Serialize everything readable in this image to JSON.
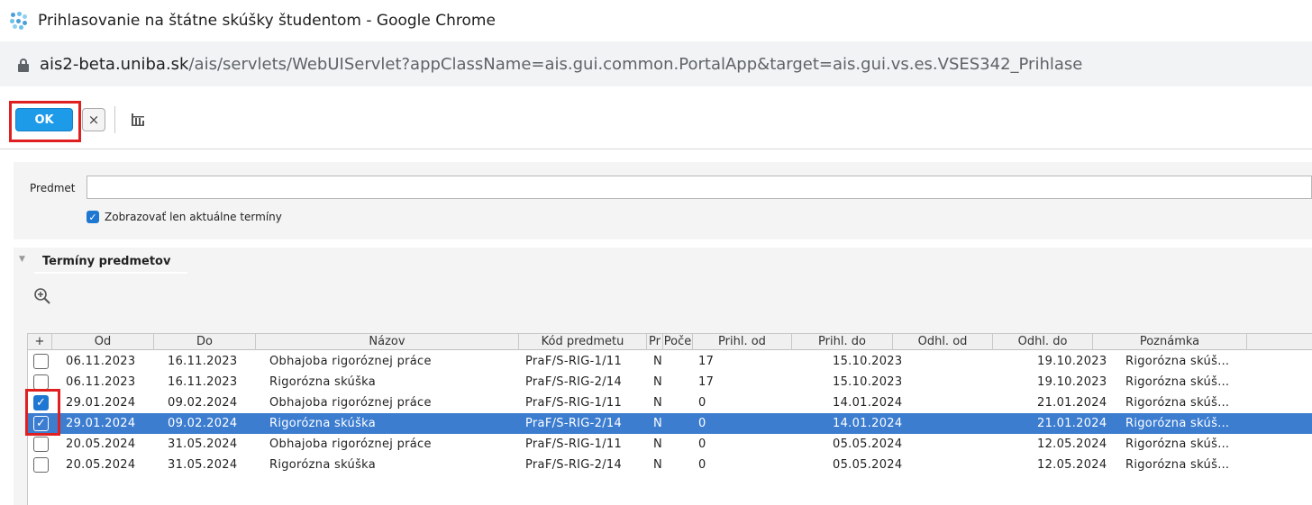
{
  "window": {
    "title": "Prihlasovanie na štátne skúšky študentom - Google Chrome",
    "url_host": "ais2-beta.uniba.sk",
    "url_path": "/ais/servlets/WebUIServlet?appClassName=ais.gui.common.PortalApp&target=ais.gui.vs.es.VSES342_Prihlase"
  },
  "toolbar": {
    "ok_label": "OK",
    "cancel_symbol": "×"
  },
  "filter": {
    "predmet_label": "Predmet",
    "predmet_value": "",
    "current_only_label": "Zobrazovať len aktuálne termíny",
    "current_only_checked": true
  },
  "section": {
    "title": "Termíny predmetov"
  },
  "table": {
    "add_symbol": "+",
    "columns": {
      "od": "Od",
      "do": "Do",
      "nazov": "Názov",
      "kod": "Kód predmetu",
      "pr": "Pr",
      "poc": "Poče",
      "prihl_od": "Prihl. od",
      "prihl_do": "Prihl. do",
      "odhl_od": "Odhl. od",
      "odhl_do": "Odhl. do",
      "poznamka": "Poznámka"
    },
    "rows": [
      {
        "checked": false,
        "selected": false,
        "od": "06.11.2023",
        "do": "16.11.2023",
        "nazov": "Obhajoba rigoróznej práce",
        "kod": "PraF/S-RIG-1/11",
        "pr": "N",
        "poc": "17",
        "prihl_do": "15.10.2023",
        "odhl_do": "19.10.2023",
        "poznamka": "Rigorózna skúš…"
      },
      {
        "checked": false,
        "selected": false,
        "od": "06.11.2023",
        "do": "16.11.2023",
        "nazov": "Rigorózna skúška",
        "kod": "PraF/S-RIG-2/14",
        "pr": "N",
        "poc": "17",
        "prihl_do": "15.10.2023",
        "odhl_do": "19.10.2023",
        "poznamka": "Rigorózna skúš…"
      },
      {
        "checked": true,
        "selected": false,
        "od": "29.01.2024",
        "do": "09.02.2024",
        "nazov": "Obhajoba rigoróznej práce",
        "kod": "PraF/S-RIG-1/11",
        "pr": "N",
        "poc": "0",
        "prihl_do": "14.01.2024",
        "odhl_do": "21.01.2024",
        "poznamka": "Rigorózna skúš…"
      },
      {
        "checked": true,
        "selected": true,
        "od": "29.01.2024",
        "do": "09.02.2024",
        "nazov": "Rigorózna skúška",
        "kod": "PraF/S-RIG-2/14",
        "pr": "N",
        "poc": "0",
        "prihl_do": "14.01.2024",
        "odhl_do": "21.01.2024",
        "poznamka": "Rigorózna skúš…"
      },
      {
        "checked": false,
        "selected": false,
        "od": "20.05.2024",
        "do": "31.05.2024",
        "nazov": "Obhajoba rigoróznej práce",
        "kod": "PraF/S-RIG-1/11",
        "pr": "N",
        "poc": "0",
        "prihl_do": "05.05.2024",
        "odhl_do": "12.05.2024",
        "poznamka": "Rigorózna skúš…"
      },
      {
        "checked": false,
        "selected": false,
        "od": "20.05.2024",
        "do": "31.05.2024",
        "nazov": "Rigorózna skúška",
        "kod": "PraF/S-RIG-2/14",
        "pr": "N",
        "poc": "0",
        "prihl_do": "05.05.2024",
        "odhl_do": "12.05.2024",
        "poznamka": "Rigorózna skúš…"
      }
    ]
  },
  "colors": {
    "accent": "#1e9be8",
    "selection": "#3c7dd0",
    "highlight": "#e02020"
  },
  "icons": {
    "app": "app-dots-icon",
    "lock": "lock-icon",
    "grid": "grid-columns-icon",
    "zoom": "zoom-in-icon",
    "collapse": "collapse-triangle-icon"
  }
}
